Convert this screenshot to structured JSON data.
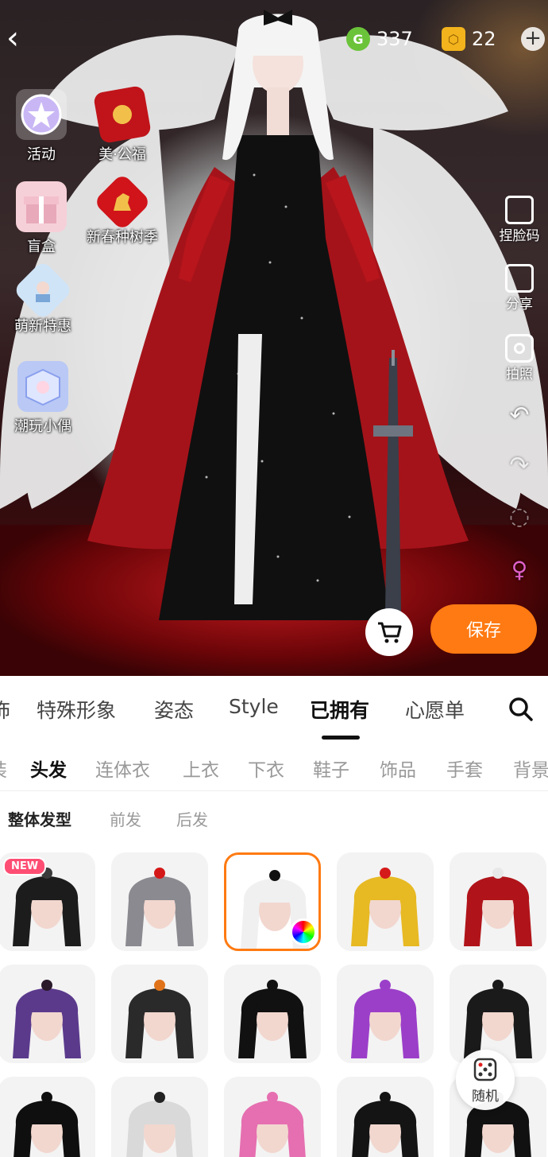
{
  "header": {
    "currency_green": "337",
    "currency_gold": "22"
  },
  "left_nav": [
    {
      "label": "活动",
      "icon": "star-badge-icon"
    },
    {
      "label": "美·公福",
      "icon": "red-envelope-icon"
    },
    {
      "label": "盲盒",
      "icon": "gift-box-icon"
    },
    {
      "label": "新春种树季",
      "icon": "horse-lantern-icon"
    },
    {
      "label": "萌新特惠",
      "icon": "character-card-icon"
    },
    {
      "label": "潮玩小偶",
      "icon": "cube-figure-icon"
    }
  ],
  "right_tools": [
    {
      "label": "捏脸码",
      "icon": "face-code-icon"
    },
    {
      "label": "分享",
      "icon": "share-icon"
    },
    {
      "label": "拍照",
      "icon": "camera-icon"
    }
  ],
  "actions": {
    "save_label": "保存",
    "random_label": "随机"
  },
  "main_tabs": [
    {
      "label": "饰"
    },
    {
      "label": "特殊形象"
    },
    {
      "label": "姿态"
    },
    {
      "label": "Style"
    },
    {
      "label": "已拥有",
      "active": true
    },
    {
      "label": "心愿单"
    }
  ],
  "category_tabs": [
    {
      "label": "装"
    },
    {
      "label": "头发",
      "active": true
    },
    {
      "label": "连体衣"
    },
    {
      "label": "上衣"
    },
    {
      "label": "下衣"
    },
    {
      "label": "鞋子"
    },
    {
      "label": "饰品"
    },
    {
      "label": "手套"
    },
    {
      "label": "背景"
    }
  ],
  "sub_tabs": [
    {
      "label": "整体发型",
      "active": true
    },
    {
      "label": "前发"
    },
    {
      "label": "后发"
    }
  ],
  "items": [
    {
      "tag": "NEW",
      "hair": "#1c1c1c",
      "accent": "#3a3a3a"
    },
    {
      "hair": "#8a8a90",
      "accent": "#d41818"
    },
    {
      "hair": "#f0f0f0",
      "accent": "#111111",
      "selected": true
    },
    {
      "hair": "#e7b923",
      "accent": "#d51a1a"
    },
    {
      "hair": "#b0141a",
      "accent": "#e8e8e8"
    },
    {
      "hair": "#5b3a8c",
      "accent": "#2a1a2a"
    },
    {
      "hair": "#2a2a2a",
      "accent": "#e0731a"
    },
    {
      "hair": "#111111",
      "accent": "#111111"
    },
    {
      "hair": "#9b3fc9",
      "accent": "#9b3fc9"
    },
    {
      "hair": "#1a1a1a",
      "accent": "#1a1a1a"
    },
    {
      "hair": "#0f0f0f",
      "accent": "#0f0f0f"
    },
    {
      "hair": "#d9d9d9",
      "accent": "#222222"
    },
    {
      "hair": "#e56fb0",
      "accent": "#e56fb0"
    },
    {
      "hair": "#141414",
      "accent": "#141414"
    },
    {
      "hair": "#111111",
      "accent": "#111111"
    }
  ],
  "colors": {
    "accent": "#ff7a12",
    "new_tag": "#ff4e73"
  }
}
